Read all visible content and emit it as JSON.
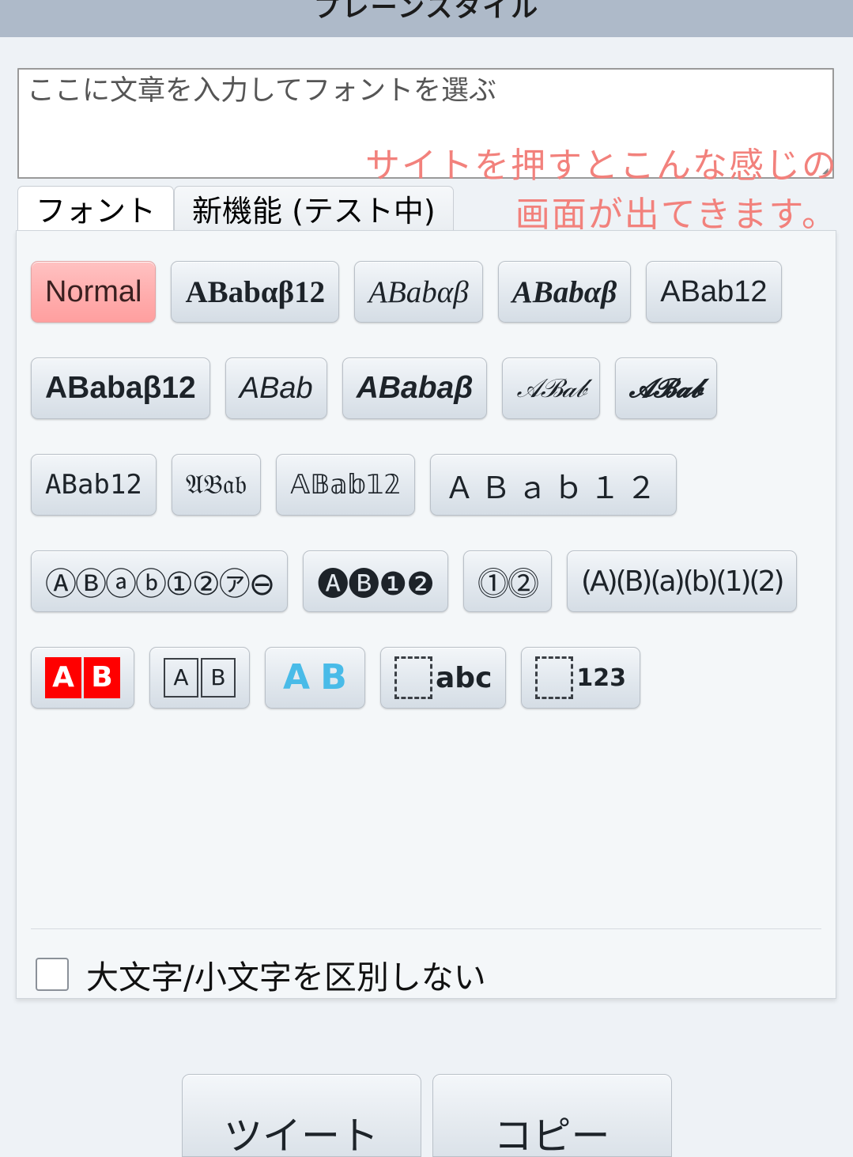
{
  "titlebar": {
    "title": "プレーンスタイル"
  },
  "input": {
    "value": "ここに文章を入力してフォントを選ぶ",
    "placeholder": "ここに文章を入力してフォントを選ぶ"
  },
  "annotation": {
    "line1": "サイトを押すとこんな感じの",
    "line2": "画面が出てきます。",
    "color": "#f2817c"
  },
  "tabs": [
    {
      "label": "フォント",
      "active": true
    },
    {
      "label": "新機能 (テスト中)",
      "active": false
    }
  ],
  "style_rows": [
    {
      "buttons": [
        {
          "label": "Normal",
          "style": "f-normal",
          "selected": true
        },
        {
          "label": "ABabαβ12",
          "style": "f-serif-b",
          "selected": false
        },
        {
          "label": "ABabαβ",
          "style": "f-serif-i",
          "selected": false
        },
        {
          "label": "ABabαβ",
          "style": "f-serif-bi",
          "selected": false
        },
        {
          "label": "ABab12",
          "style": "f-sans",
          "selected": false
        }
      ]
    },
    {
      "buttons": [
        {
          "label": "ABabaβ12",
          "style": "f-sans-b",
          "selected": false
        },
        {
          "label": "ABab",
          "style": "f-sans-i",
          "selected": false
        },
        {
          "label": "ABabaβ",
          "style": "f-sans-bi",
          "selected": false
        },
        {
          "label": "𝒜ℬ𝒶𝒷",
          "style": "f-script",
          "selected": false
        },
        {
          "label": "𝓐𝓑𝓪𝓫",
          "style": "f-script-b",
          "selected": false
        }
      ]
    },
    {
      "buttons": [
        {
          "label": "ABab12",
          "style": "f-mono",
          "selected": false
        },
        {
          "label": "𝔄𝔅𝔞𝔟",
          "style": "f-fraktur",
          "selected": false
        },
        {
          "label": "𝔸𝔹𝕒𝕓𝟙𝟚",
          "style": "f-double",
          "selected": false
        },
        {
          "label": "ＡＢａｂ１２",
          "style": "f-wide",
          "selected": false
        }
      ]
    },
    {
      "buttons": [
        {
          "label": "ⒶⒷⓐⓑ①②㋐⊖",
          "style": "f-circ",
          "selected": false
        },
        {
          "label": "🅐🅑❶❷",
          "style": "f-circ-neg",
          "selected": false
        },
        {
          "label": "⓵⓶",
          "style": "f-circ-dbl",
          "selected": false
        },
        {
          "label": "(A)(B)(a)(b)(1)(2)",
          "style": "f-paren",
          "selected": false
        }
      ]
    }
  ],
  "squared_row": {
    "buttons": [
      {
        "name": "squared-red",
        "kind": "squares",
        "variant": "red",
        "chars": [
          "A",
          "B"
        ]
      },
      {
        "name": "squared-outline",
        "kind": "squares",
        "variant": "out",
        "chars": [
          "A",
          "B"
        ]
      },
      {
        "name": "squared-blue",
        "kind": "squares",
        "variant": "blue",
        "chars": [
          "A",
          "B"
        ]
      },
      {
        "name": "tofu-abc",
        "kind": "tofu",
        "label": "abc"
      },
      {
        "name": "tofu-123",
        "kind": "tofu",
        "label": "123"
      }
    ]
  },
  "checkbox": {
    "label": "大文字/小文字を区別しない",
    "checked": false
  },
  "actions": [
    {
      "label": "ツイート"
    },
    {
      "label": "コピー"
    }
  ],
  "colors": {
    "titlebar": "#aebac9",
    "page_bg": "#eef2f6",
    "panel_bg": "#f4f7f9",
    "selected_button": "#ffadad",
    "annotation_red": "#f2817c",
    "squared_red": "#ff0000",
    "squared_blue": "#49bbe8"
  }
}
